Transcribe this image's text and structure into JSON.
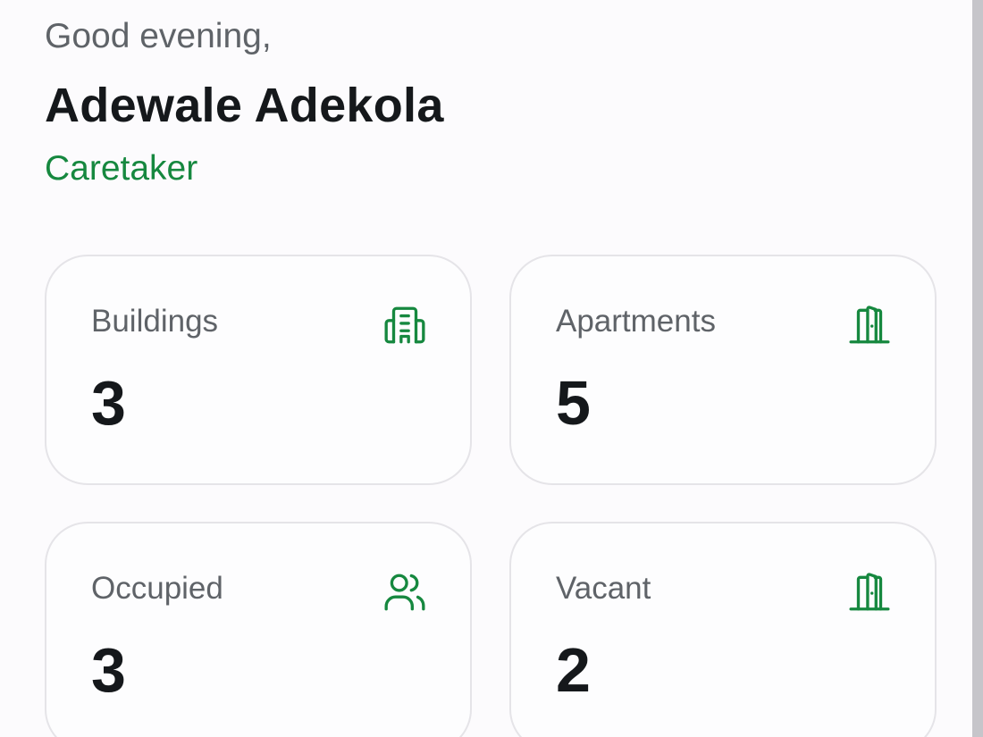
{
  "header": {
    "greeting": "Good evening,",
    "user_name": "Adewale Adekola",
    "role": "Caretaker"
  },
  "stats": {
    "buildings": {
      "label": "Buildings",
      "value": "3",
      "icon": "building-icon"
    },
    "apartments": {
      "label": "Apartments",
      "value": "5",
      "icon": "door-icon"
    },
    "occupied": {
      "label": "Occupied",
      "value": "3",
      "icon": "users-icon"
    },
    "vacant": {
      "label": "Vacant",
      "value": "2",
      "icon": "door-icon"
    }
  },
  "colors": {
    "accent": "#16883f",
    "text_primary": "#15181b",
    "text_secondary": "#5f6368",
    "card_border": "#e5e4e8",
    "background": "#fcfbfd"
  }
}
